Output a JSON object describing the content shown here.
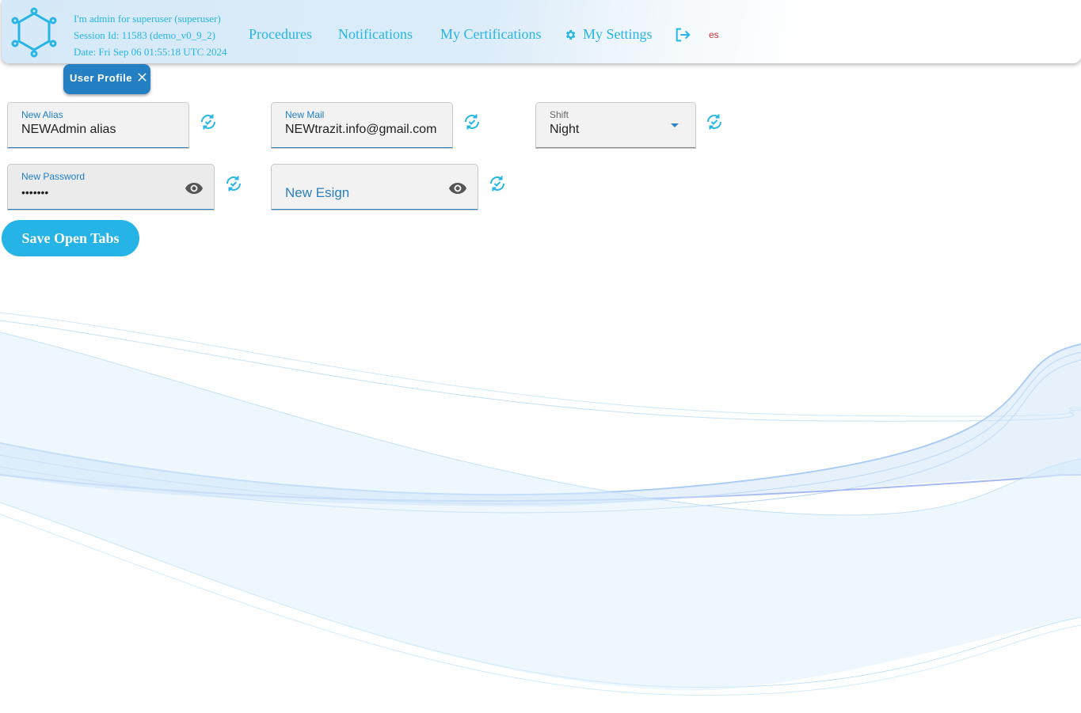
{
  "session": {
    "user_line": "I'm admin for superuser (superuser)",
    "session_line": "Session Id: 11583 (demo_v0_9_2)",
    "date_line": "Date: Fri Sep 06 01:55:18 UTC 2024"
  },
  "nav": {
    "procedures": "Procedures",
    "notifications": "Notifications",
    "certifications": "My Certifications",
    "settings": "My Settings",
    "language": "es"
  },
  "tab": {
    "label": "User Profile"
  },
  "form": {
    "alias": {
      "label": "New Alias",
      "value": "NEWAdmin alias"
    },
    "mail": {
      "label": "New Mail",
      "value": "NEWtrazit.info@gmail.com"
    },
    "shift": {
      "label": "Shift",
      "value": "Night"
    },
    "password": {
      "label": "New Password",
      "value": "•••••••"
    },
    "esign": {
      "placeholder": "New Esign"
    }
  },
  "actions": {
    "save_label": "Save Open Tabs"
  },
  "icons": {
    "logo": "molecule-logo-icon",
    "settings": "gear-icon",
    "logout": "logout-icon",
    "close": "close-icon",
    "visibility": "eye-icon",
    "refresh": "refresh-check-icon",
    "dropdown": "caret-down-icon"
  },
  "colors": {
    "accent": "#26b5e6",
    "tab": "#2480c2",
    "field_bg": "#f2f2f2",
    "language": "#d3302f"
  }
}
